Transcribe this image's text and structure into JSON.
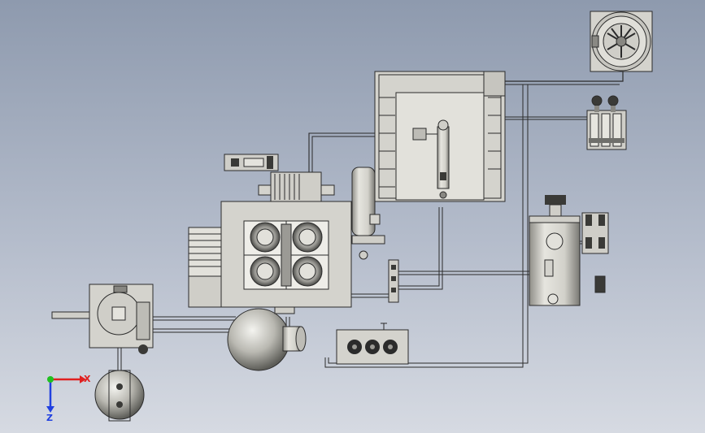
{
  "viewport": {
    "background_top": "#8e9aae",
    "background_bottom": "#d6dae2"
  },
  "colors": {
    "metal_light": "#e4e3dd",
    "metal_mid": "#c9c8c1",
    "metal_dark": "#6f6f6b",
    "outline": "#2b2b2b",
    "pipe": "#d8d8d2"
  },
  "triad": {
    "x_label": "X",
    "z_label": "Z",
    "x_color": "#e02020",
    "y_color": "#20c020",
    "z_color": "#2040e0"
  },
  "components": [
    "fan-unit",
    "heat-exchanger-frame",
    "valve-cluster-top",
    "motor-block",
    "compressor-block",
    "vertical-separator",
    "pressure-vessel-right",
    "valve-cluster-right",
    "filter-housing-left",
    "spherical-tank-center",
    "spherical-tank-bottom",
    "control-box-three-dials"
  ]
}
